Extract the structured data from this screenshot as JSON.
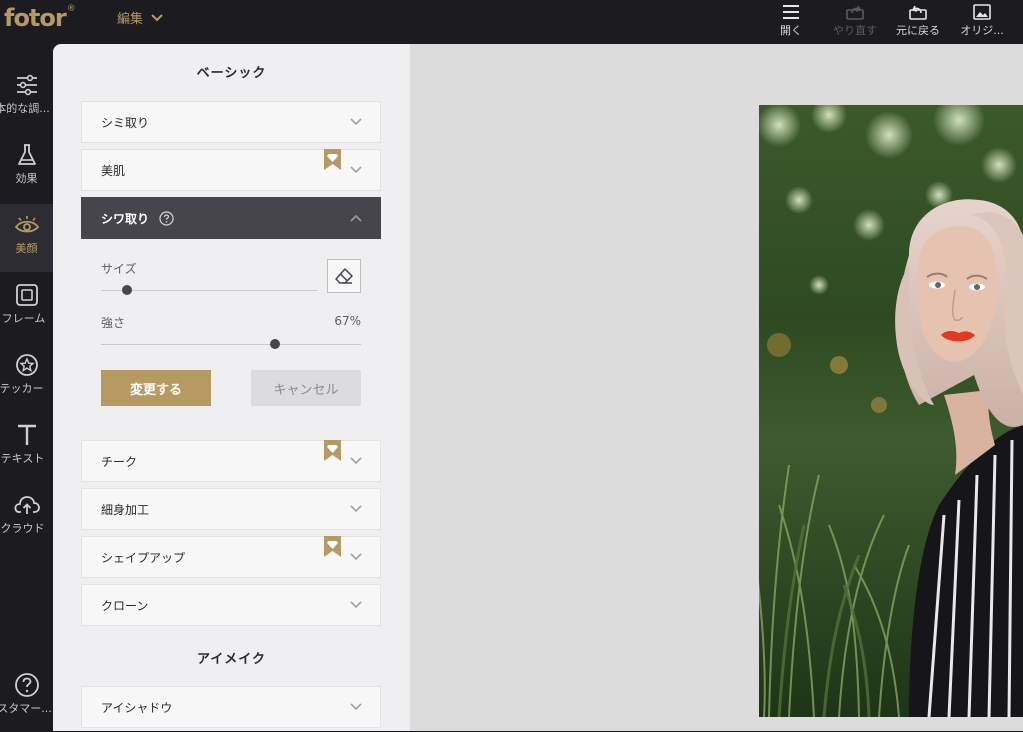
{
  "app": {
    "logo": "fotor",
    "logo_mark": "®",
    "edit_menu": "編集"
  },
  "toolbar": {
    "open": "開く",
    "redo": "やり直す",
    "undo": "元に戻る",
    "original": "オリジ..."
  },
  "rail": [
    {
      "label": "本的な調...",
      "icon": "sliders-icon"
    },
    {
      "label": "効果",
      "icon": "flask-icon"
    },
    {
      "label": "美顔",
      "icon": "eye-icon"
    },
    {
      "label": "フレーム",
      "icon": "frame-icon"
    },
    {
      "label": "テッカー",
      "icon": "star-badge-icon"
    },
    {
      "label": "テキスト",
      "icon": "text-icon"
    },
    {
      "label": "クラウド",
      "icon": "cloud-upload-icon"
    },
    {
      "label": "スタマー...",
      "icon": "help-icon"
    }
  ],
  "panel": {
    "basic_title": "ベーシック",
    "eye_title": "アイメイク",
    "rows": {
      "blemish": "シミ取り",
      "skin": "美肌",
      "wrinkle": "シワ取り",
      "cheek": "チーク",
      "slim": "細身加工",
      "reshape": "シェイプアップ",
      "clone": "クローン",
      "eyeshadow": "アイシャドウ"
    },
    "wrinkle_tool": {
      "size_label": "サイズ",
      "size_value": 0.12,
      "strength_label": "強さ",
      "strength_value_text": "67%",
      "strength_value": 0.67,
      "apply": "変更する",
      "cancel": "キャンセル"
    }
  },
  "colors": {
    "accent": "#b69a62",
    "dark_bar": "#1c1c20",
    "panel_bg": "#efeff1",
    "expanded_row": "#45454b"
  }
}
